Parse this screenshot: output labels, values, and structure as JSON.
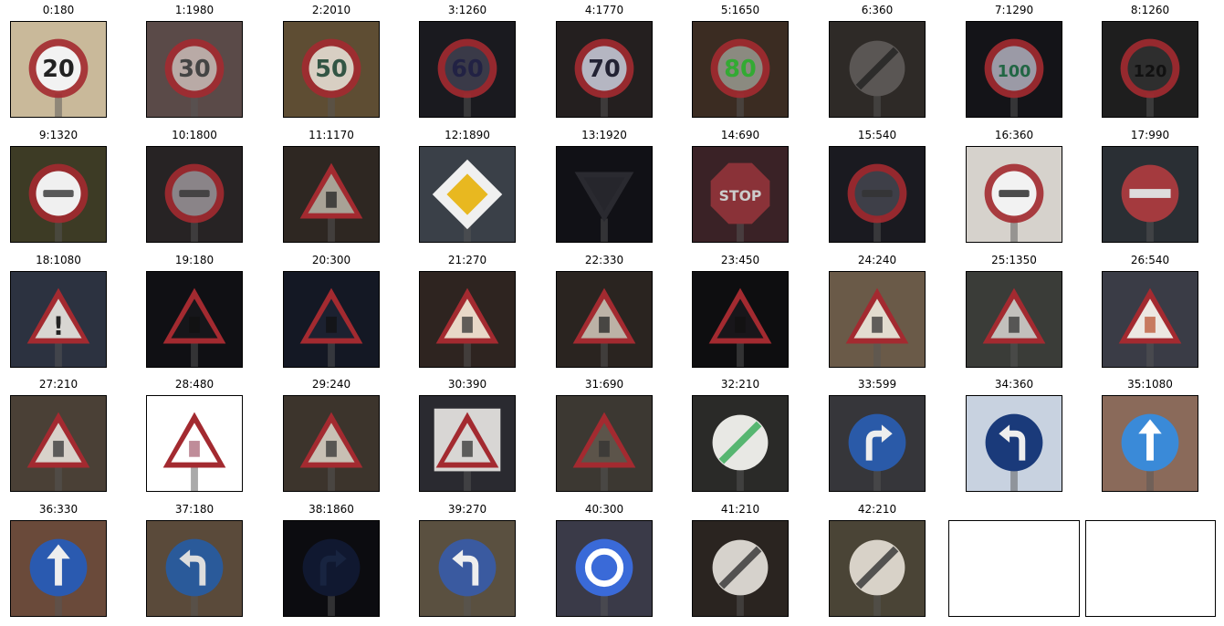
{
  "grid": {
    "cells": [
      {
        "label": "0:180",
        "icon": "speed-limit-20-sign",
        "bg": "#c9b99a",
        "kind": "circle-red",
        "glyph": "20",
        "fg": "#f2f2f2",
        "gc": "#222"
      },
      {
        "label": "1:1980",
        "icon": "speed-limit-30-sign",
        "bg": "#5a4a48",
        "kind": "circle-red",
        "glyph": "30",
        "fg": "#b9aaa6",
        "gc": "#444"
      },
      {
        "label": "2:2010",
        "icon": "speed-limit-50-sign",
        "bg": "#5e4d33",
        "kind": "circle-red",
        "glyph": "50",
        "fg": "#d8cfc3",
        "gc": "#354"
      },
      {
        "label": "3:1260",
        "icon": "speed-limit-60-sign",
        "bg": "#1a1a1f",
        "kind": "circle-red",
        "glyph": "60",
        "fg": "#3a3a48",
        "gc": "#224"
      },
      {
        "label": "4:1770",
        "icon": "speed-limit-70-sign",
        "bg": "#241f1f",
        "kind": "circle-red",
        "glyph": "70",
        "fg": "#b5b6c2",
        "gc": "#223"
      },
      {
        "label": "5:1650",
        "icon": "speed-limit-80-sign",
        "bg": "#3b2c22",
        "kind": "circle-red",
        "glyph": "80",
        "fg": "#8b8a80",
        "gc": "#3a3"
      },
      {
        "label": "6:360",
        "icon": "end-speed-limit-80-sign",
        "bg": "#2e2a27",
        "kind": "circle-end",
        "glyph": "",
        "fg": "#5a5654",
        "gc": "#222"
      },
      {
        "label": "7:1290",
        "icon": "speed-limit-100-sign",
        "bg": "#141418",
        "kind": "circle-red",
        "glyph": "100",
        "fg": "#9b9aa6",
        "gc": "#264"
      },
      {
        "label": "8:1260",
        "icon": "speed-limit-120-sign",
        "bg": "#1e1e1e",
        "kind": "circle-red",
        "glyph": "120",
        "fg": "#2e2e2e",
        "gc": "#111"
      },
      {
        "label": "9:1320",
        "icon": "no-overtaking-sign",
        "bg": "#3d3b25",
        "kind": "circle-red",
        "glyph": "",
        "fg": "#f0f0f0",
        "gc": "#333"
      },
      {
        "label": "10:1800",
        "icon": "no-overtaking-trucks-sign",
        "bg": "#272324",
        "kind": "circle-red",
        "glyph": "",
        "fg": "#8a8488",
        "gc": "#333"
      },
      {
        "label": "11:1170",
        "icon": "right-of-way-sign",
        "bg": "#2e2722",
        "kind": "triangle",
        "glyph": "",
        "fg": "#a8a296",
        "gc": "#222"
      },
      {
        "label": "12:1890",
        "icon": "priority-road-sign",
        "bg": "#3a4048",
        "kind": "diamond",
        "glyph": "",
        "fg": "#f0f0f0",
        "gc": "#e8b820"
      },
      {
        "label": "13:1920",
        "icon": "yield-sign",
        "bg": "#111116",
        "kind": "yield",
        "glyph": "",
        "fg": "#26262c",
        "gc": "#111"
      },
      {
        "label": "14:690",
        "icon": "stop-sign",
        "bg": "#3a2226",
        "kind": "stop",
        "glyph": "STOP",
        "fg": "#8a3238",
        "gc": "#ccc"
      },
      {
        "label": "15:540",
        "icon": "no-vehicles-sign",
        "bg": "#1a1a20",
        "kind": "circle-red",
        "glyph": "",
        "fg": "#3e3f48",
        "gc": "#333"
      },
      {
        "label": "16:360",
        "icon": "trucks-prohibited-sign",
        "bg": "#d6d2cc",
        "kind": "circle-red",
        "glyph": "",
        "fg": "#f2f2f2",
        "gc": "#222"
      },
      {
        "label": "17:990",
        "icon": "no-entry-sign",
        "bg": "#2a2f34",
        "kind": "noentry",
        "glyph": "",
        "fg": "#a43a3e",
        "gc": "#ddd"
      },
      {
        "label": "18:1080",
        "icon": "general-caution-sign",
        "bg": "#2c3240",
        "kind": "triangle",
        "glyph": "!",
        "fg": "#d8d6d2",
        "gc": "#222"
      },
      {
        "label": "19:180",
        "icon": "dangerous-curve-left-sign",
        "bg": "#101014",
        "kind": "triangle",
        "glyph": "",
        "fg": "#16161a",
        "gc": "#111"
      },
      {
        "label": "20:300",
        "icon": "dangerous-curve-right-sign",
        "bg": "#141824",
        "kind": "triangle",
        "glyph": "",
        "fg": "#1c2130",
        "gc": "#111"
      },
      {
        "label": "21:270",
        "icon": "double-curve-sign",
        "bg": "#2e2420",
        "kind": "triangle",
        "glyph": "",
        "fg": "#e8d8c8",
        "gc": "#333"
      },
      {
        "label": "22:330",
        "icon": "bumpy-road-sign",
        "bg": "#2a2420",
        "kind": "triangle",
        "glyph": "",
        "fg": "#bcb2a6",
        "gc": "#222"
      },
      {
        "label": "23:450",
        "icon": "slippery-road-sign",
        "bg": "#0e0e10",
        "kind": "triangle",
        "glyph": "",
        "fg": "#18161a",
        "gc": "#111"
      },
      {
        "label": "24:240",
        "icon": "road-narrows-sign",
        "bg": "#6a5a48",
        "kind": "triangle",
        "glyph": "",
        "fg": "#e2dccf",
        "gc": "#333"
      },
      {
        "label": "25:1350",
        "icon": "road-work-sign",
        "bg": "#3a3c38",
        "kind": "triangle",
        "glyph": "",
        "fg": "#c2c0bc",
        "gc": "#333"
      },
      {
        "label": "26:540",
        "icon": "traffic-signals-sign",
        "bg": "#3a3c46",
        "kind": "triangle",
        "glyph": "",
        "fg": "#ece8e2",
        "gc": "#b53"
      },
      {
        "label": "27:210",
        "icon": "pedestrians-sign",
        "bg": "#4a4036",
        "kind": "triangle",
        "glyph": "",
        "fg": "#d8d2ca",
        "gc": "#333"
      },
      {
        "label": "28:480",
        "icon": "children-crossing-sign",
        "bg": "#ffffff",
        "kind": "triangle",
        "glyph": "",
        "fg": "#ffffff",
        "gc": "#a67"
      },
      {
        "label": "29:240",
        "icon": "bicycles-crossing-sign",
        "bg": "#3c342c",
        "kind": "triangle",
        "glyph": "",
        "fg": "#c8c0b4",
        "gc": "#333"
      },
      {
        "label": "30:390",
        "icon": "beware-ice-snow-sign",
        "bg": "#2a2a30",
        "kind": "triangle-box",
        "glyph": "",
        "fg": "#d8d6d4",
        "gc": "#333"
      },
      {
        "label": "31:690",
        "icon": "wild-animals-crossing-sign",
        "bg": "#3c3832",
        "kind": "triangle",
        "glyph": "",
        "fg": "#5c544a",
        "gc": "#333"
      },
      {
        "label": "32:210",
        "icon": "end-all-limits-sign",
        "bg": "#2a2a28",
        "kind": "circle-end",
        "glyph": "",
        "fg": "#e8e8e4",
        "gc": "#3a5"
      },
      {
        "label": "33:599",
        "icon": "turn-right-ahead-sign",
        "bg": "#36363a",
        "kind": "circle-blue",
        "glyph": "right",
        "fg": "#2a5aa8",
        "gc": "#eee"
      },
      {
        "label": "34:360",
        "icon": "turn-left-ahead-sign",
        "bg": "#c8d2e0",
        "kind": "circle-blue",
        "glyph": "left",
        "fg": "#1a3a7a",
        "gc": "#eee"
      },
      {
        "label": "35:1080",
        "icon": "ahead-only-sign",
        "bg": "#8a6a5a",
        "kind": "circle-blue",
        "glyph": "up",
        "fg": "#3a8ad8",
        "gc": "#fff"
      },
      {
        "label": "36:330",
        "icon": "go-straight-or-right-sign",
        "bg": "#6a4a3a",
        "kind": "circle-blue",
        "glyph": "up",
        "fg": "#2a5ab0",
        "gc": "#eee"
      },
      {
        "label": "37:180",
        "icon": "go-straight-or-left-sign",
        "bg": "#5a4a3a",
        "kind": "circle-blue",
        "glyph": "left",
        "fg": "#2a5a9a",
        "gc": "#ddd"
      },
      {
        "label": "38:1860",
        "icon": "keep-right-sign",
        "bg": "#0c0c10",
        "kind": "circle-blue",
        "glyph": "right",
        "fg": "#101830",
        "gc": "#182440"
      },
      {
        "label": "39:270",
        "icon": "keep-left-sign",
        "bg": "#5a5040",
        "kind": "circle-blue",
        "glyph": "left",
        "fg": "#3a5aa0",
        "gc": "#eee"
      },
      {
        "label": "40:300",
        "icon": "roundabout-mandatory-sign",
        "bg": "#3a3a48",
        "kind": "circle-blue",
        "glyph": "round",
        "fg": "#3a6ad8",
        "gc": "#fff"
      },
      {
        "label": "41:210",
        "icon": "end-of-no-passing-sign",
        "bg": "#2a2420",
        "kind": "circle-end",
        "glyph": "",
        "fg": "#d6d2cc",
        "gc": "#333"
      },
      {
        "label": "42:210",
        "icon": "end-no-passing-trucks-sign",
        "bg": "#4a4436",
        "kind": "circle-end",
        "glyph": "",
        "fg": "#d8d2c8",
        "gc": "#333"
      }
    ]
  }
}
